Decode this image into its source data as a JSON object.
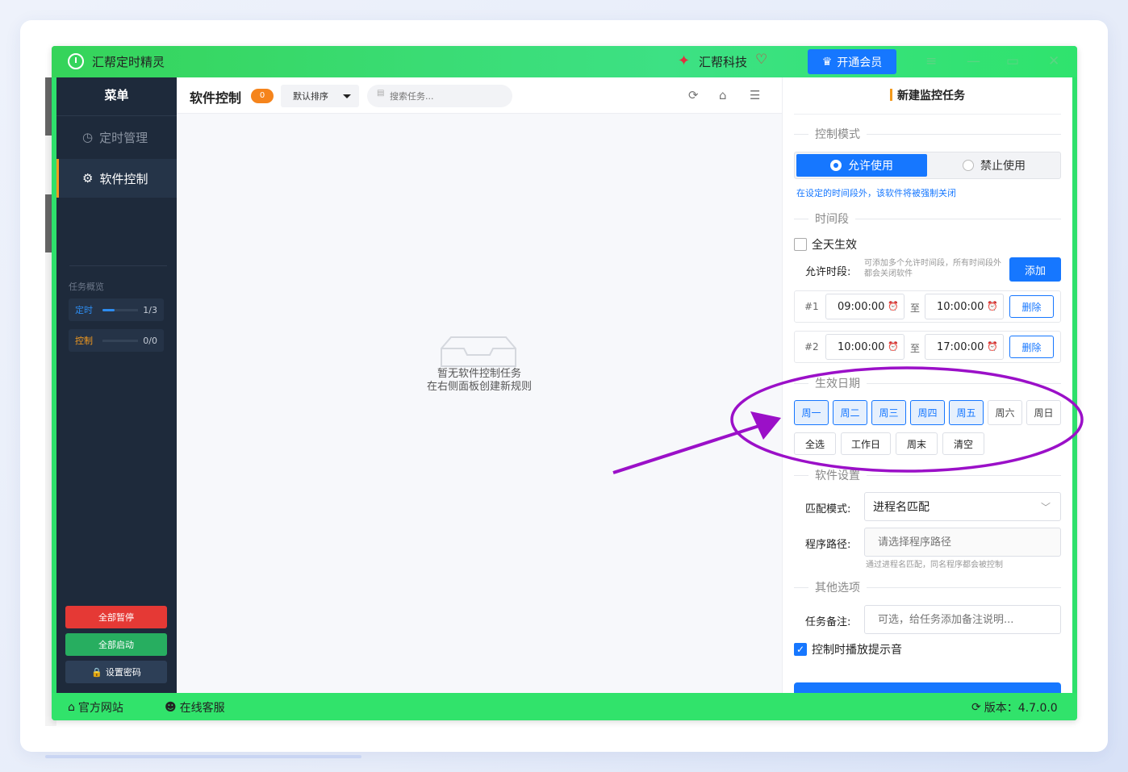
{
  "app": {
    "title": "汇帮定时精灵",
    "brand": "汇帮科技",
    "vip_label": "开通会员",
    "icons": [
      "alarm-clock-icon",
      "brand-logo-icon",
      "heart-icon",
      "crown-icon",
      "menu-icon",
      "minimize-icon",
      "maximize-icon",
      "close-icon"
    ]
  },
  "sidebar": {
    "menu_title": "菜单",
    "items": [
      {
        "label": "定时管理",
        "icon": "clock-icon",
        "active": false
      },
      {
        "label": "软件控制",
        "icon": "gear-icon",
        "active": true
      }
    ],
    "overview_title": "任务概览",
    "overview": [
      {
        "label": "定时",
        "count": "1/3",
        "progress": 0.33,
        "color": "#2d8cf0"
      },
      {
        "label": "控制",
        "count": "0/0",
        "progress": 0,
        "color": "#f39a1e"
      }
    ],
    "buttons": {
      "pause_all": "全部暂停",
      "start_all": "全部启动",
      "set_password": "设置密码"
    },
    "colors": {
      "pause": "#e53935",
      "start": "#27ae60",
      "password": "#2d3f57"
    }
  },
  "main": {
    "title": "软件控制",
    "badge": "0",
    "sort_label": "默认排序",
    "search_placeholder": "搜索任务...",
    "empty_line1": "暂无软件控制任务",
    "empty_line2": "在右侧面板创建新规则"
  },
  "panel": {
    "title": "新建监控任务",
    "mode_section": "控制模式",
    "mode_allow": "允许使用",
    "mode_deny": "禁止使用",
    "mode_hint": "在设定的时间段外，该软件将被强制关闭",
    "time_section": "时间段",
    "all_day": "全天生效",
    "allow_label": "允许时段:",
    "allow_hint": "可添加多个允许时间段，所有时间段外都会关闭软件",
    "add_label": "添加",
    "to_label": "至",
    "delete_label": "删除",
    "slots": [
      {
        "index": "#1",
        "start": "09:00:00",
        "end": "10:00:00"
      },
      {
        "index": "#2",
        "start": "10:00:00",
        "end": "17:00:00"
      }
    ],
    "date_section": "生效日期",
    "days": [
      {
        "label": "周一",
        "selected": true
      },
      {
        "label": "周二",
        "selected": true
      },
      {
        "label": "周三",
        "selected": true
      },
      {
        "label": "周四",
        "selected": true
      },
      {
        "label": "周五",
        "selected": true
      },
      {
        "label": "周六",
        "selected": false
      },
      {
        "label": "周日",
        "selected": false
      }
    ],
    "quick": [
      "全选",
      "工作日",
      "周末",
      "清空"
    ],
    "software_section": "软件设置",
    "match_label": "匹配模式:",
    "match_value": "进程名匹配",
    "path_label": "程序路径:",
    "path_placeholder": "请选择程序路径",
    "path_hint": "通过进程名匹配，同名程序都会被控制",
    "other_section": "其他选项",
    "note_label": "任务备注:",
    "note_placeholder": "可选，给任务添加备注说明...",
    "sound_label": "控制时播放提示音",
    "sound_checked": true
  },
  "footer": {
    "website": "官方网站",
    "service": "在线客服",
    "version": "版本：4.7.0.0"
  },
  "colors": {
    "accent": "#1677ff",
    "titlebar_green": "#35d45a",
    "sidebar_bg": "#1e2a3b",
    "orange": "#f39a1e",
    "annotation_purple": "#9b10c8"
  }
}
